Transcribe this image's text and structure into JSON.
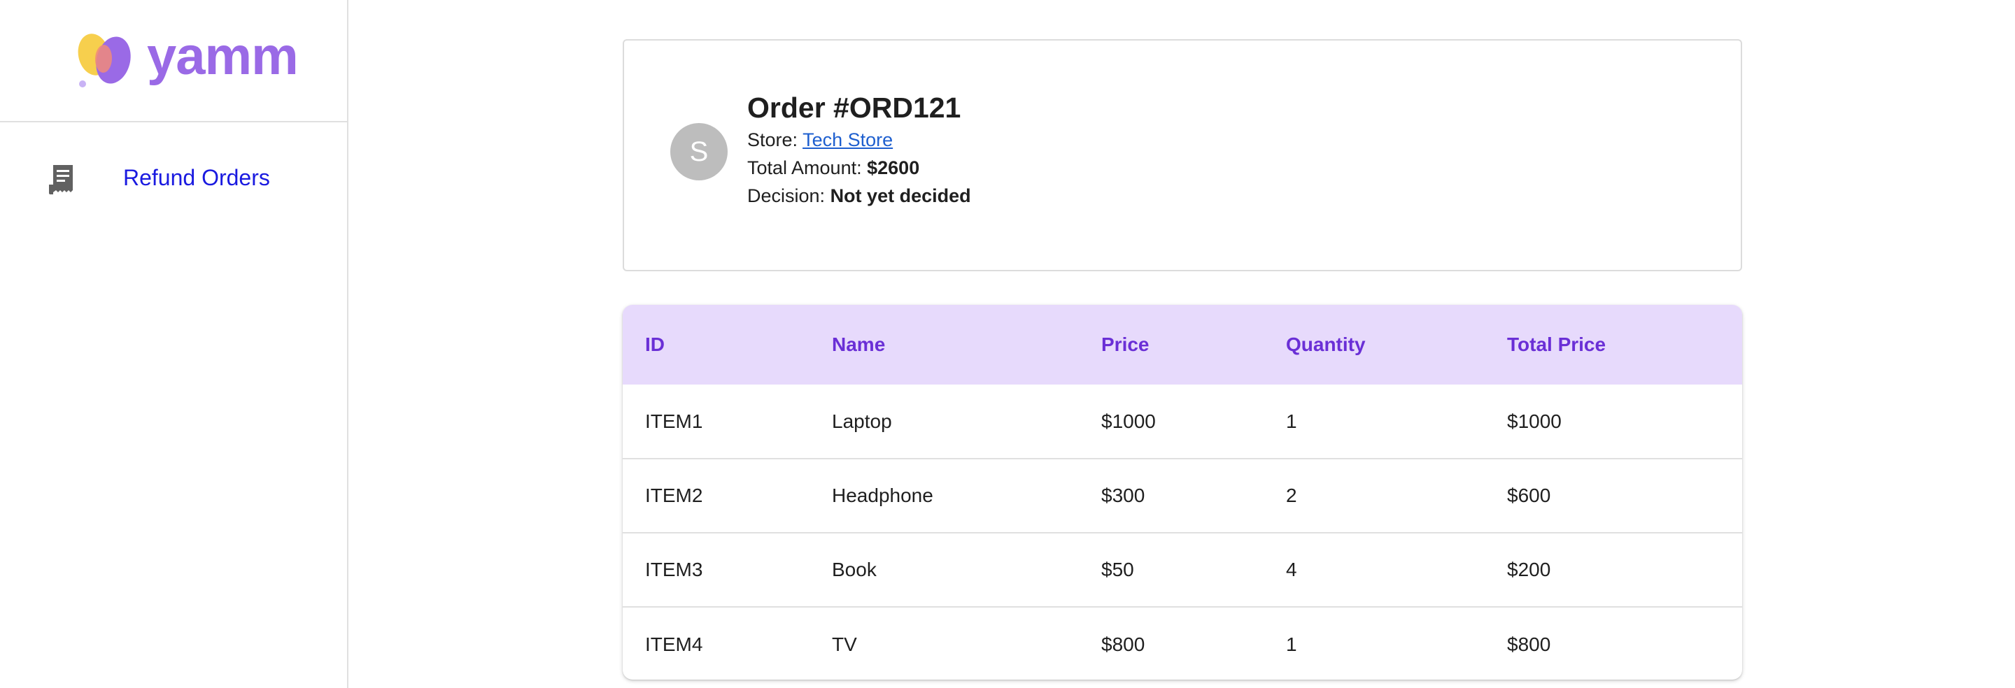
{
  "brand": {
    "name": "yamm"
  },
  "sidebar": {
    "items": [
      {
        "label": "Refund Orders",
        "icon": "receipt-icon"
      }
    ]
  },
  "order": {
    "avatar_initial": "S",
    "title": "Order #ORD121",
    "store_label": "Store:",
    "store_name": "Tech Store",
    "total_label": "Total Amount:",
    "total_value": "$2600",
    "decision_label": "Decision:",
    "decision_value": "Not yet decided"
  },
  "table": {
    "headers": [
      "ID",
      "Name",
      "Price",
      "Quantity",
      "Total Price"
    ],
    "rows": [
      [
        "ITEM1",
        "Laptop",
        "$1000",
        "1",
        "$1000"
      ],
      [
        "ITEM2",
        "Headphone",
        "$300",
        "2",
        "$600"
      ],
      [
        "ITEM3",
        "Book",
        "$50",
        "4",
        "$200"
      ],
      [
        "ITEM4",
        "TV",
        "$800",
        "1",
        "$800"
      ]
    ]
  },
  "colors": {
    "brand": "#9a6ae6",
    "nav_link": "#1a1ae0",
    "table_header_bg": "#e7dafc",
    "table_header_text": "#6a2fd6",
    "link": "#1e5fcf",
    "avatar_bg": "#bdbdbd"
  }
}
